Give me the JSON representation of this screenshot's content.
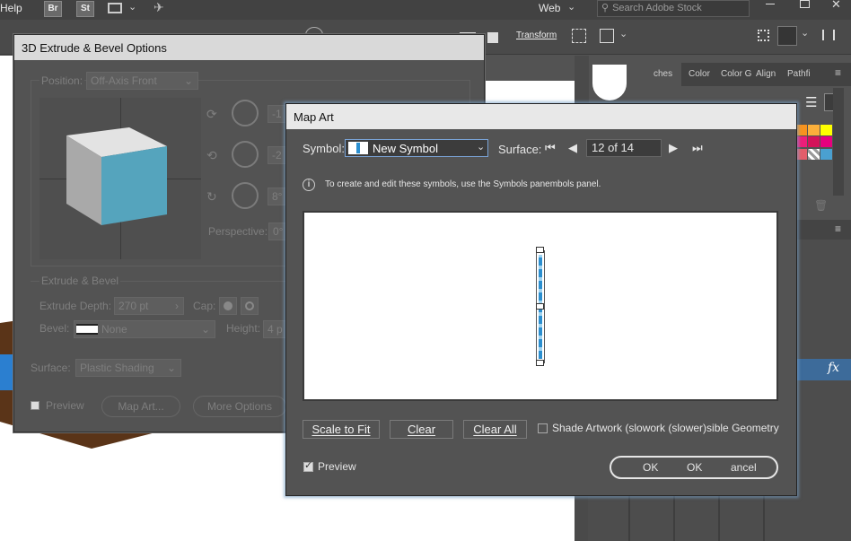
{
  "menubar": {
    "help_label": "Help",
    "bridge_label": "Br",
    "stock_label": "St",
    "workspace_label": "Web",
    "search_placeholder": "Search Adobe Stock"
  },
  "control_bar": {
    "transform_label": "Transform"
  },
  "panel_tabs": [
    "ches",
    "Color",
    "Color G",
    "Align",
    "Pathfi"
  ],
  "panel_colors": {
    "swatch_row1": [
      "#f7931e",
      "#fbb03b",
      "#ffff00"
    ],
    "swatch_row2": [
      "#ed1e79",
      "#d4145a",
      "#e6007e"
    ]
  },
  "dialog_3d": {
    "title": "3D Extrude & Bevel Options",
    "position_label": "Position:",
    "position_value": "Off-Axis Front",
    "rot_x_value": "-1",
    "rot_y_value": "-2",
    "rot_z_value": "8°",
    "perspective_label": "Perspective:",
    "perspective_value": "0°",
    "section_extrude": "Extrude & Bevel",
    "extrude_depth_label": "Extrude Depth:",
    "extrude_depth_value": "270 pt",
    "cap_label": "Cap:",
    "bevel_label": "Bevel:",
    "bevel_value": "None",
    "height_label": "Height:",
    "height_value": "4 p",
    "surface_label": "Surface:",
    "surface_value": "Plastic Shading",
    "preview_label": "Preview",
    "map_art_button": "Map Art...",
    "more_options_button": "More Options",
    "cube_colors": {
      "front": "#55a4bd",
      "top": "#e3e3e3",
      "side": "#a9a9a9"
    }
  },
  "map_art": {
    "title": "Map Art",
    "symbol_label": "Symbol:",
    "symbol_value": "New Symbol",
    "surface_label": "Surface:",
    "surface_value": "12 of 14",
    "info_text": "To create and edit these symbols, use the Symbols panembols panel.",
    "scale_to_fit_button": "Scale to Fit",
    "clear_button": "Clear",
    "clear_all_button": "Clear All",
    "shade_artwork_label": "Shade Artwork (slowork (slower)sible Geometry",
    "preview_label": "Preview",
    "ok_button": "OK",
    "ok_button_2": "OK",
    "cancel_button": "ancel",
    "symbol_color": "#2b8fd0"
  }
}
